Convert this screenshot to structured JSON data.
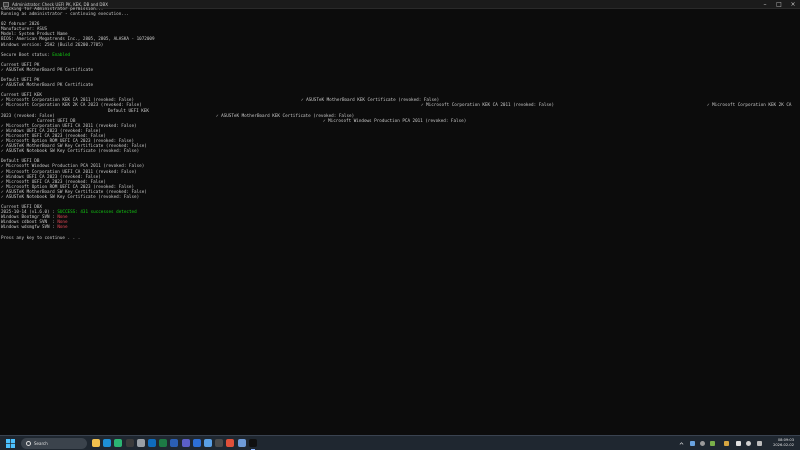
{
  "window": {
    "title": "Administrator: Check UEFI PK, KEK, DB and DBX"
  },
  "console": {
    "lines": [
      {
        "segs": [
          {
            "text": "Checking for Administrator permission..."
          }
        ]
      },
      {
        "segs": [
          {
            "text": "Running as administrator - continuing execution..."
          }
        ]
      },
      {
        "segs": [
          {
            "text": ""
          }
        ]
      },
      {
        "segs": [
          {
            "text": "02 februar 2026"
          }
        ]
      },
      {
        "segs": [
          {
            "text": "Manufacturer: ASUS"
          }
        ]
      },
      {
        "segs": [
          {
            "text": "Model: System Product Name"
          }
        ]
      },
      {
        "segs": [
          {
            "text": "BIOS: American Megatrends Inc., 2805, 2805, ALASKA - 1072009"
          }
        ]
      },
      {
        "segs": [
          {
            "text": "Windows version: 25H2 (Build 26200.7705)"
          }
        ]
      },
      {
        "segs": [
          {
            "text": ""
          }
        ]
      },
      {
        "segs": [
          {
            "text": "Secure Boot status: "
          },
          {
            "text": "Enabled",
            "cls": "green"
          }
        ]
      },
      {
        "segs": [
          {
            "text": ""
          }
        ]
      },
      {
        "segs": [
          {
            "text": "Current UEFI PK"
          }
        ]
      },
      {
        "segs": [
          {
            "text": "✓ ASUSTeK MotherBoard PK Certificate"
          }
        ]
      },
      {
        "segs": [
          {
            "text": ""
          }
        ]
      },
      {
        "segs": [
          {
            "text": "Default UEFI PK"
          }
        ]
      },
      {
        "segs": [
          {
            "text": "✓ ASUSTeK MotherBoard PK Certificate"
          }
        ]
      },
      {
        "segs": [
          {
            "text": ""
          }
        ]
      },
      {
        "segs": [
          {
            "text": "Current UEFI KEK"
          }
        ]
      },
      {
        "segs": [
          {
            "text": "✓ Microsoft Corporation KEK CA 2011 (revoked: False)"
          },
          {
            "text": "✓ ASUSTeK MotherBoard KEK Certificate (revoked: False)",
            "col": 300
          }
        ]
      },
      {
        "segs": [
          {
            "text": "✓ Microsoft Corporation KEK 2K CA 2023 (revoked: False)"
          },
          {
            "text": "✓ Microsoft Corporation KEK CA 2011 (revoked: False)",
            "col": 420
          },
          {
            "text": "✓ Microsoft Corporation KEK 2K CA",
            "col": 706
          }
        ]
      },
      {
        "segs": [
          {
            "text": "Default UEFI KEK",
            "col": 107
          }
        ]
      },
      {
        "segs": [
          {
            "text": "2023 (revoked: False)"
          },
          {
            "text": "✓ ASUSTeK MotherBoard KEK Certificate (revoked: False)",
            "col": 215
          }
        ]
      },
      {
        "segs": [
          {
            "text": "Current UEFI DB",
            "col": 36
          },
          {
            "text": "✓ Microsoft Windows Production PCA 2011 (revoked: False)",
            "col": 322
          }
        ]
      },
      {
        "segs": [
          {
            "text": "✓ Microsoft Corporation UEFI CA 2011 (revoked: False)"
          }
        ]
      },
      {
        "segs": [
          {
            "text": "✓ Windows UEFI CA 2023 (revoked: False)"
          }
        ]
      },
      {
        "segs": [
          {
            "text": "✓ Microsoft UEFI CA 2023 (revoked: False)"
          }
        ]
      },
      {
        "segs": [
          {
            "text": "✓ Microsoft Option ROM UEFI CA 2023 (revoked: False)"
          }
        ]
      },
      {
        "segs": [
          {
            "text": "✓ ASUSTeK MotherBoard SW Key Certificate (revoked: False)"
          }
        ]
      },
      {
        "segs": [
          {
            "text": "✓ ASUSTeK Notebook SW Key Certificate (revoked: False)"
          }
        ]
      },
      {
        "segs": [
          {
            "text": ""
          }
        ]
      },
      {
        "segs": [
          {
            "text": "Default UEFI DB"
          }
        ]
      },
      {
        "segs": [
          {
            "text": "✓ Microsoft Windows Production PCA 2011 (revoked: False)"
          }
        ]
      },
      {
        "segs": [
          {
            "text": "✓ Microsoft Corporation UEFI CA 2011 (revoked: False)"
          }
        ]
      },
      {
        "segs": [
          {
            "text": "✓ Windows UEFI CA 2023 (revoked: False)"
          }
        ]
      },
      {
        "segs": [
          {
            "text": "✓ Microsoft UEFI CA 2023 (revoked: False)"
          }
        ]
      },
      {
        "segs": [
          {
            "text": "✓ Microsoft Option ROM UEFI CA 2023 (revoked: False)"
          }
        ]
      },
      {
        "segs": [
          {
            "text": "✓ ASUSTeK MotherBoard SW Key Certificate (revoked: False)"
          }
        ]
      },
      {
        "segs": [
          {
            "text": "✓ ASUSTeK Notebook SW Key Certificate (revoked: False)"
          }
        ]
      },
      {
        "segs": [
          {
            "text": ""
          }
        ]
      },
      {
        "segs": [
          {
            "text": "Current UEFI DBX"
          }
        ]
      },
      {
        "segs": [
          {
            "text": "2025-10-14 (v1.6.0) : "
          },
          {
            "text": "SUCCESS: 431 successes detected",
            "cls": "green"
          }
        ]
      },
      {
        "segs": [
          {
            "text": "Windows Bootmgr SVN : "
          },
          {
            "text": "None",
            "cls": "red"
          }
        ]
      },
      {
        "segs": [
          {
            "text": "Windows cdboot SVN  : "
          },
          {
            "text": "None",
            "cls": "red"
          }
        ]
      },
      {
        "segs": [
          {
            "text": "Windows wdsmgfw SVN : "
          },
          {
            "text": "None",
            "cls": "red"
          }
        ]
      },
      {
        "segs": [
          {
            "text": ""
          }
        ]
      },
      {
        "segs": [
          {
            "text": "Press any key to continue . . ."
          }
        ]
      }
    ]
  },
  "taskbar": {
    "search_placeholder": "Search",
    "apps": [
      {
        "name": "file-explorer-icon",
        "color": "#f2c14e"
      },
      {
        "name": "browser-icon",
        "color": "#1e90d6"
      },
      {
        "name": "edge-icon",
        "color": "#2bb673"
      },
      {
        "name": "terminal-app-icon",
        "color": "#3b3b3b"
      },
      {
        "name": "settings-icon",
        "color": "#9aa0a6"
      },
      {
        "name": "mail-icon",
        "color": "#0f6cbd"
      },
      {
        "name": "excel-icon",
        "color": "#1d7a45"
      },
      {
        "name": "word-icon",
        "color": "#2b5fb4"
      },
      {
        "name": "teams-icon",
        "color": "#5b5fc7"
      },
      {
        "name": "store-icon",
        "color": "#2d6fd6"
      },
      {
        "name": "photos-icon",
        "color": "#5aa0e6"
      },
      {
        "name": "calculator-icon",
        "color": "#4a4a4a"
      },
      {
        "name": "brave-icon",
        "color": "#e0503a"
      },
      {
        "name": "notepad-icon",
        "color": "#6e9bd8"
      },
      {
        "name": "cmd-icon",
        "color": "#101010"
      }
    ],
    "time": "08:09:03",
    "date": "2026-02-02"
  }
}
